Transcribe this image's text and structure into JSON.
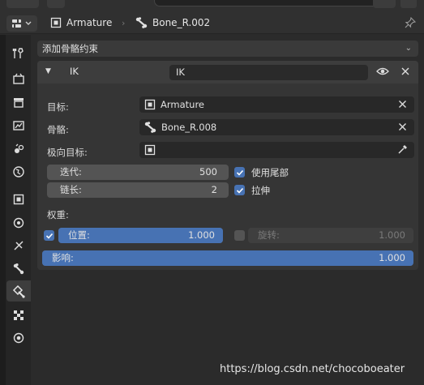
{
  "header": {
    "object_name": "Armature",
    "bone_name": "Bone_R.002"
  },
  "add_constraint": {
    "label": "添加骨骼约束"
  },
  "constraint": {
    "type_label": "IK",
    "name_value": "IK",
    "fields": {
      "target_label": "目标:",
      "target_value": "Armature",
      "bone_label": "骨骼:",
      "bone_value": "Bone_R.008",
      "pole_label": "极向目标:",
      "pole_value": ""
    },
    "iterations_label": "迭代:",
    "iterations_value": "500",
    "chain_label": "链长:",
    "chain_value": "2",
    "use_tail_label": "使用尾部",
    "use_tail": true,
    "stretch_label": "拉伸",
    "stretch": true,
    "weight_label": "权重:",
    "position_label": "位置:",
    "position_value": "1.000",
    "position_enabled": true,
    "rotation_label": "旋转:",
    "rotation_value": "1.000",
    "rotation_enabled": false,
    "influence_label": "影响:",
    "influence_value": "1.000"
  },
  "watermark": "https://blog.csdn.net/chocoboeater",
  "colors": {
    "accent": "#4772b3",
    "panel": "#353535",
    "background": "#2b2b2b"
  }
}
